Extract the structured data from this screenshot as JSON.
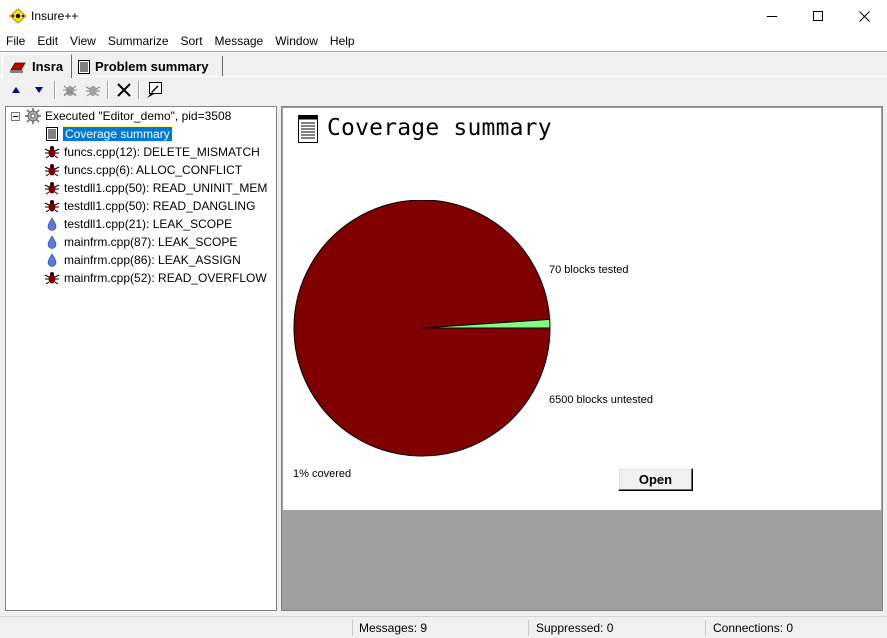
{
  "window": {
    "title": "Insure++",
    "minimize_glyph": "—",
    "maximize_glyph": "☐",
    "close_glyph": "✕"
  },
  "menu": [
    "File",
    "Edit",
    "View",
    "Summarize",
    "Sort",
    "Message",
    "Window",
    "Help"
  ],
  "tabs": [
    {
      "label": "Insra",
      "icon": "insra-icon",
      "active": true
    },
    {
      "label": "Problem summary",
      "icon": "document-icon",
      "active": false
    }
  ],
  "toolbar": {
    "icons": [
      "arrow-up-icon",
      "arrow-down-icon",
      "bug-disabled-icon",
      "bug-disabled-icon",
      "delete-x-icon",
      "edit-icon"
    ]
  },
  "tree": {
    "root": {
      "label": "Executed \"Editor_demo\", pid=3508",
      "icon": "gear-icon"
    },
    "items": [
      {
        "label": "Coverage summary",
        "icon": "document-icon",
        "selected": true
      },
      {
        "label": "funcs.cpp(12): DELETE_MISMATCH",
        "icon": "bug-icon"
      },
      {
        "label": "funcs.cpp(6): ALLOC_CONFLICT",
        "icon": "bug-icon"
      },
      {
        "label": "testdll1.cpp(50): READ_UNINIT_MEM",
        "icon": "bug-icon"
      },
      {
        "label": "testdll1.cpp(50): READ_DANGLING",
        "icon": "bug-icon"
      },
      {
        "label": "testdll1.cpp(21): LEAK_SCOPE",
        "icon": "drop-icon"
      },
      {
        "label": "mainfrm.cpp(87): LEAK_SCOPE",
        "icon": "drop-icon"
      },
      {
        "label": "mainfrm.cpp(86): LEAK_ASSIGN",
        "icon": "drop-icon"
      },
      {
        "label": "mainfrm.cpp(52): READ_OVERFLOW",
        "icon": "bug-icon"
      }
    ]
  },
  "coverage": {
    "title": "Coverage summary",
    "tested_label": "70 blocks tested",
    "untested_label": "6500 blocks untested",
    "covered_label": "1% covered",
    "open_button": "Open",
    "tested_blocks": 70,
    "untested_blocks": 6500,
    "colors": {
      "tested": "#80ff80",
      "untested": "#800000"
    }
  },
  "status": {
    "messages": "Messages: 9",
    "suppressed": "Suppressed: 0",
    "connections": "Connections: 0"
  }
}
